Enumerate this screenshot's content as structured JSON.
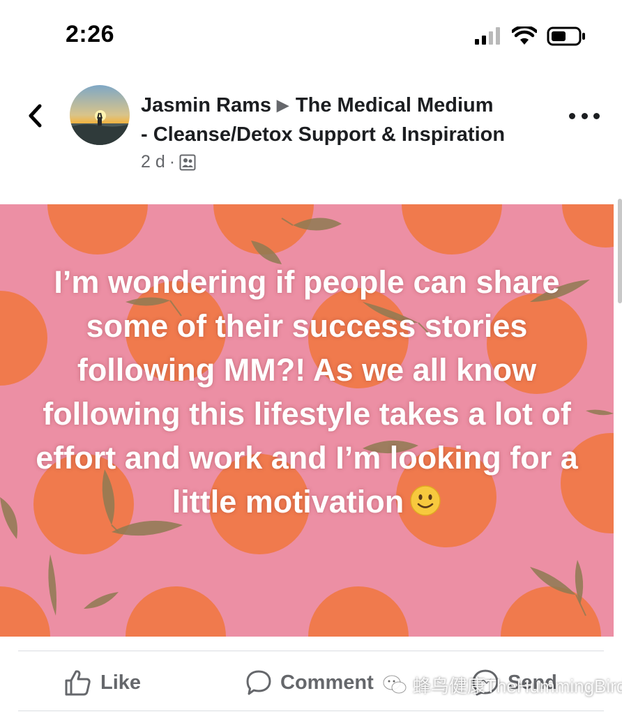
{
  "status_bar": {
    "time": "2:26",
    "icons": [
      "cellular-signal-icon",
      "wifi-icon",
      "battery-icon"
    ]
  },
  "header": {
    "author": "Jasmin Rams",
    "group_line1": "The Medical Medium",
    "group_line2": "- Cleanse/Detox Support & Inspiration",
    "timestamp": "2 d",
    "separator": "·",
    "audience_icon": "group-audience-icon"
  },
  "post": {
    "text": "I’m wondering if people can share some of their success stories following MM?! As we all know following this lifestyle takes a lot of effort and work and I’m looking for a little motivation",
    "emoji": "slightly-smiling-face",
    "background_color": "#ec8fa4",
    "pattern_color": "#f07a4d",
    "leaf_color": "#8f7a52"
  },
  "actions": {
    "like": "Like",
    "comment": "Comment",
    "send": "Send"
  },
  "watermark": {
    "text": "蜂鸟健康TheHummingBird",
    "icon": "wechat-icon"
  }
}
